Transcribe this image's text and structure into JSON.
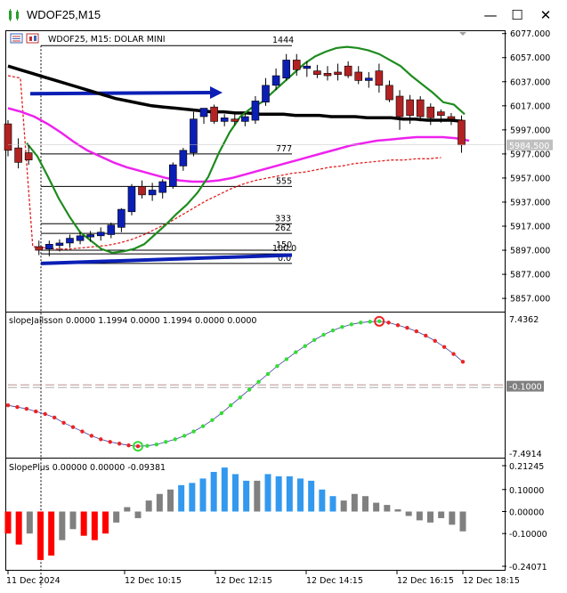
{
  "window": {
    "title": "WDOF25,M15",
    "minimize_glyph": "—",
    "maximize_glyph": "☐",
    "close_glyph": "✕"
  },
  "main_panel": {
    "header": "WDOF25, M15:  DOLAR MINI",
    "price_ticks": [
      "6077.000",
      "6057.000",
      "6037.000",
      "6017.000",
      "5997.000",
      "5977.000",
      "5957.000",
      "5937.000",
      "5917.000",
      "5897.000",
      "5877.000",
      "5857.000"
    ],
    "current_price": "5984.500",
    "fib_labels": [
      "1444",
      "777",
      "555",
      "333",
      "262",
      "150",
      "100.0",
      "0.0"
    ]
  },
  "slope_panel": {
    "header": "slopeJailsson 0.0000 1.1994 0.0000 1.1994 0.0000 0.0000",
    "ticks": [
      "7.4362",
      "-0.1000",
      "-7.4914"
    ]
  },
  "slopeplus_panel": {
    "header": "SlopePlus 0.00000 0.00000 -0.09381",
    "ticks": [
      "0.21245",
      "0.10000",
      "0.00000",
      "-0.10000",
      "-0.24071"
    ]
  },
  "time_axis": {
    "labels": [
      "11 Dec 2024",
      "12 Dec 10:15",
      "12 Dec 12:15",
      "12 Dec 14:15",
      "12 Dec 16:15",
      "12 Dec 18:15"
    ]
  },
  "colors": {
    "bull": "#0b1fb5",
    "bear": "#b22222",
    "ma_green": "#1e8c1e",
    "ma_magenta": "#ee22ee",
    "ma_black": "#000000",
    "hist_red": "#ff0000",
    "hist_blue": "#3399ee",
    "hist_gray": "#808080"
  },
  "chart_data": [
    {
      "type": "candlestick",
      "title": "WDOF25, M15:  DOLAR MINI",
      "ylim": [
        5846,
        6079
      ],
      "candles": [
        {
          "o": 6002,
          "h": 6005,
          "l": 5975,
          "c": 5980
        },
        {
          "o": 5982,
          "h": 5990,
          "l": 5965,
          "c": 5970
        },
        {
          "o": 5978,
          "h": 5985,
          "l": 5968,
          "c": 5972
        },
        {
          "o": 5900,
          "h": 5905,
          "l": 5893,
          "c": 5897
        },
        {
          "o": 5898,
          "h": 5905,
          "l": 5892,
          "c": 5902
        },
        {
          "o": 5901,
          "h": 5906,
          "l": 5896,
          "c": 5903
        },
        {
          "o": 5903,
          "h": 5910,
          "l": 5899,
          "c": 5907
        },
        {
          "o": 5905,
          "h": 5912,
          "l": 5902,
          "c": 5909
        },
        {
          "o": 5908,
          "h": 5913,
          "l": 5904,
          "c": 5910
        },
        {
          "o": 5909,
          "h": 5916,
          "l": 5905,
          "c": 5912
        },
        {
          "o": 5910,
          "h": 5920,
          "l": 5907,
          "c": 5918
        },
        {
          "o": 5916,
          "h": 5932,
          "l": 5912,
          "c": 5931
        },
        {
          "o": 5929,
          "h": 5952,
          "l": 5926,
          "c": 5950
        },
        {
          "o": 5950,
          "h": 5955,
          "l": 5940,
          "c": 5943
        },
        {
          "o": 5943,
          "h": 5953,
          "l": 5938,
          "c": 5947
        },
        {
          "o": 5945,
          "h": 5956,
          "l": 5940,
          "c": 5954
        },
        {
          "o": 5950,
          "h": 5970,
          "l": 5948,
          "c": 5968
        },
        {
          "o": 5967,
          "h": 5982,
          "l": 5963,
          "c": 5980
        },
        {
          "o": 5978,
          "h": 6012,
          "l": 5975,
          "c": 6006
        },
        {
          "o": 6008,
          "h": 6015,
          "l": 6002,
          "c": 6015
        },
        {
          "o": 6016,
          "h": 6018,
          "l": 6002,
          "c": 6004
        },
        {
          "o": 6004,
          "h": 6010,
          "l": 6000,
          "c": 6007
        },
        {
          "o": 6006,
          "h": 6012,
          "l": 6001,
          "c": 6004
        },
        {
          "o": 6004,
          "h": 6011,
          "l": 6000,
          "c": 6008
        },
        {
          "o": 6005,
          "h": 6025,
          "l": 6002,
          "c": 6021
        },
        {
          "o": 6020,
          "h": 6040,
          "l": 6017,
          "c": 6034
        },
        {
          "o": 6034,
          "h": 6048,
          "l": 6030,
          "c": 6042
        },
        {
          "o": 6040,
          "h": 6060,
          "l": 6038,
          "c": 6055
        },
        {
          "o": 6055,
          "h": 6060,
          "l": 6042,
          "c": 6047
        },
        {
          "o": 6048,
          "h": 6054,
          "l": 6041,
          "c": 6050
        },
        {
          "o": 6046,
          "h": 6051,
          "l": 6040,
          "c": 6043
        },
        {
          "o": 6044,
          "h": 6050,
          "l": 6038,
          "c": 6042
        },
        {
          "o": 6045,
          "h": 6052,
          "l": 6038,
          "c": 6043
        },
        {
          "o": 6050,
          "h": 6054,
          "l": 6040,
          "c": 6042
        },
        {
          "o": 6045,
          "h": 6050,
          "l": 6035,
          "c": 6038
        },
        {
          "o": 6038,
          "h": 6045,
          "l": 6032,
          "c": 6040
        },
        {
          "o": 6046,
          "h": 6052,
          "l": 6028,
          "c": 6034
        },
        {
          "o": 6034,
          "h": 6038,
          "l": 6020,
          "c": 6022
        },
        {
          "o": 6025,
          "h": 6030,
          "l": 5997,
          "c": 6008
        },
        {
          "o": 6022,
          "h": 6026,
          "l": 6002,
          "c": 6009
        },
        {
          "o": 6022,
          "h": 6025,
          "l": 6004,
          "c": 6008
        },
        {
          "o": 6016,
          "h": 6019,
          "l": 6001,
          "c": 6007
        },
        {
          "o": 6012,
          "h": 6014,
          "l": 6003,
          "c": 6009
        },
        {
          "o": 6008,
          "h": 6011,
          "l": 6001,
          "c": 6006
        },
        {
          "o": 6005,
          "h": 6009,
          "l": 5978,
          "c": 5984.5
        }
      ],
      "ma_green": [
        5986,
        5975,
        5958,
        5940,
        5925,
        5912,
        5905,
        5898,
        5895,
        5896,
        5898,
        5902,
        5910,
        5918,
        5927,
        5935,
        5945,
        5958,
        5978,
        5995,
        6008,
        6015,
        6020,
        6028,
        6036,
        6044,
        6052,
        6058,
        6062,
        6065,
        6066,
        6065,
        6063,
        6060,
        6055,
        6050,
        6042,
        6035,
        6028,
        6020,
        6018,
        6010
      ],
      "ma_magenta": [
        6015,
        6012,
        6008,
        6002,
        5995,
        5987,
        5980,
        5975,
        5970,
        5966,
        5963,
        5960,
        5957,
        5955,
        5954,
        5954,
        5955,
        5957,
        5960,
        5963,
        5966,
        5969,
        5972,
        5975,
        5978,
        5981,
        5984,
        5986,
        5988,
        5989,
        5990,
        5991,
        5991,
        5991,
        5990,
        5988
      ],
      "ma_black": [
        6050,
        6047,
        6044,
        6041,
        6038,
        6035,
        6032,
        6029,
        6026,
        6023,
        6021,
        6019,
        6017,
        6016,
        6015,
        6014,
        6013,
        6012,
        6012,
        6011,
        6011,
        6010,
        6010,
        6010,
        6009,
        6009,
        6009,
        6008,
        6008,
        6008,
        6007,
        6007,
        6007,
        6006,
        6006,
        6005,
        6005,
        6005,
        6004
      ],
      "ma_red_dashed": [
        6042,
        6040,
        5900,
        5899,
        5898,
        5898,
        5899,
        5900,
        5901,
        5903,
        5906,
        5910,
        5915,
        5920,
        5926,
        5932,
        5938,
        5943,
        5948,
        5952,
        5955,
        5957,
        5959,
        5961,
        5962,
        5964,
        5966,
        5967,
        5969,
        5970,
        5971,
        5972,
        5972,
        5973,
        5973,
        5974
      ],
      "fib_levels": [
        6067,
        5977,
        5950,
        5919,
        5911,
        5897,
        5894,
        5886
      ],
      "trend_upper": [
        6027,
        6028
      ],
      "trend_lower": [
        5886,
        5893
      ]
    },
    {
      "type": "line",
      "title": "slopeJailsson 0.0000 1.1994 0.0000 1.1994 0.0000 0.0000",
      "ylim": [
        -7.4914,
        7.4362
      ],
      "values": [
        -2.3,
        -2.5,
        -2.7,
        -3.0,
        -3.3,
        -3.7,
        -4.3,
        -4.8,
        -5.3,
        -5.8,
        -6.2,
        -6.5,
        -6.7,
        -6.9,
        -7.0,
        -6.95,
        -6.8,
        -6.5,
        -6.2,
        -5.8,
        -5.3,
        -4.7,
        -4.0,
        -3.2,
        -2.3,
        -1.4,
        -0.5,
        0.4,
        1.3,
        2.2,
        3.0,
        3.8,
        4.5,
        5.2,
        5.8,
        6.3,
        6.7,
        7.0,
        7.2,
        7.3,
        7.35,
        7.2,
        6.9,
        6.6,
        6.2,
        5.7,
        5.1,
        4.4,
        3.6,
        2.7
      ],
      "markers": {
        "green_circle_index": 14,
        "red_circle_index": 40
      }
    },
    {
      "type": "bar",
      "title": "SlopePlus 0.00000 0.00000 -0.09381",
      "ylim": [
        -0.24071,
        0.21245
      ],
      "values": [
        -0.1,
        -0.15,
        -0.1,
        -0.22,
        -0.2,
        -0.13,
        -0.08,
        -0.11,
        -0.13,
        -0.1,
        -0.05,
        0.02,
        -0.03,
        0.05,
        0.08,
        0.1,
        0.12,
        0.13,
        0.15,
        0.18,
        0.2,
        0.17,
        0.14,
        0.14,
        0.17,
        0.16,
        0.16,
        0.15,
        0.14,
        0.1,
        0.07,
        0.05,
        0.08,
        0.07,
        0.04,
        0.03,
        0.01,
        -0.02,
        -0.04,
        -0.05,
        -0.03,
        -0.06,
        -0.09
      ],
      "colors": [
        "red",
        "red",
        "gray",
        "red",
        "red",
        "gray",
        "gray",
        "red",
        "red",
        "red",
        "gray",
        "gray",
        "gray",
        "gray",
        "gray",
        "gray",
        "blue",
        "blue",
        "blue",
        "blue",
        "blue",
        "blue",
        "blue",
        "gray",
        "blue",
        "blue",
        "blue",
        "blue",
        "blue",
        "blue",
        "blue",
        "gray",
        "gray",
        "gray",
        "gray",
        "gray",
        "gray",
        "gray",
        "gray",
        "gray",
        "gray",
        "gray",
        "gray"
      ]
    }
  ]
}
